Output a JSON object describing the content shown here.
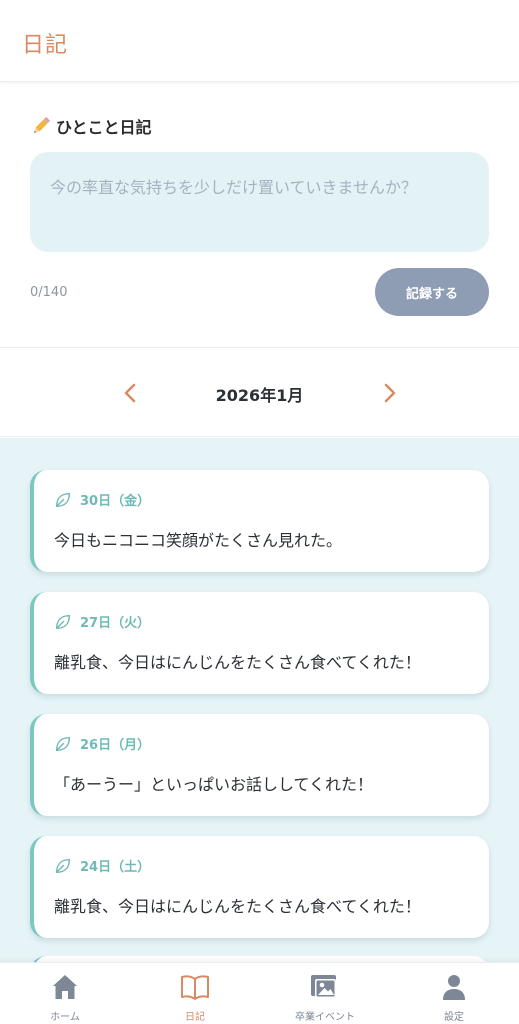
{
  "header": {
    "title": "日記"
  },
  "composer": {
    "heading_icon": "pencil-icon",
    "heading": "ひとこと日記",
    "placeholder": "今の率直な気持ちを少しだけ置いていきませんか？",
    "value": "",
    "char_count": "0/140",
    "submit_label": "記録する"
  },
  "month_nav": {
    "prev_icon": "chevron-left-icon",
    "label": "2026年1月",
    "next_icon": "chevron-right-icon"
  },
  "entries": [
    {
      "date": "30日（金）",
      "text": "今日もニコニコ笑顔がたくさん見れた。",
      "icon": "leaf-icon"
    },
    {
      "date": "27日（火）",
      "text": "離乳食、今日はにんじんをたくさん食べてくれた！",
      "icon": "leaf-icon"
    },
    {
      "date": "26日（月）",
      "text": "「あーうー」といっぱいお話ししてくれた！",
      "icon": "leaf-icon"
    },
    {
      "date": "24日（土）",
      "text": "離乳食、今日はにんじんをたくさん食べてくれた！",
      "icon": "leaf-icon"
    }
  ],
  "bottom_nav": {
    "items": [
      {
        "label": "ホーム",
        "icon": "home-icon"
      },
      {
        "label": "日記",
        "icon": "book-icon",
        "active": true
      },
      {
        "label": "卒業イベント",
        "icon": "photo-album-icon"
      },
      {
        "label": "設定",
        "icon": "person-icon"
      }
    ]
  },
  "colors": {
    "accent": "#d98a64",
    "teal": "#6fbab4",
    "input_bg": "#e2f2f5",
    "list_bg": "#e6f4f7",
    "button": "#8e9db3"
  }
}
